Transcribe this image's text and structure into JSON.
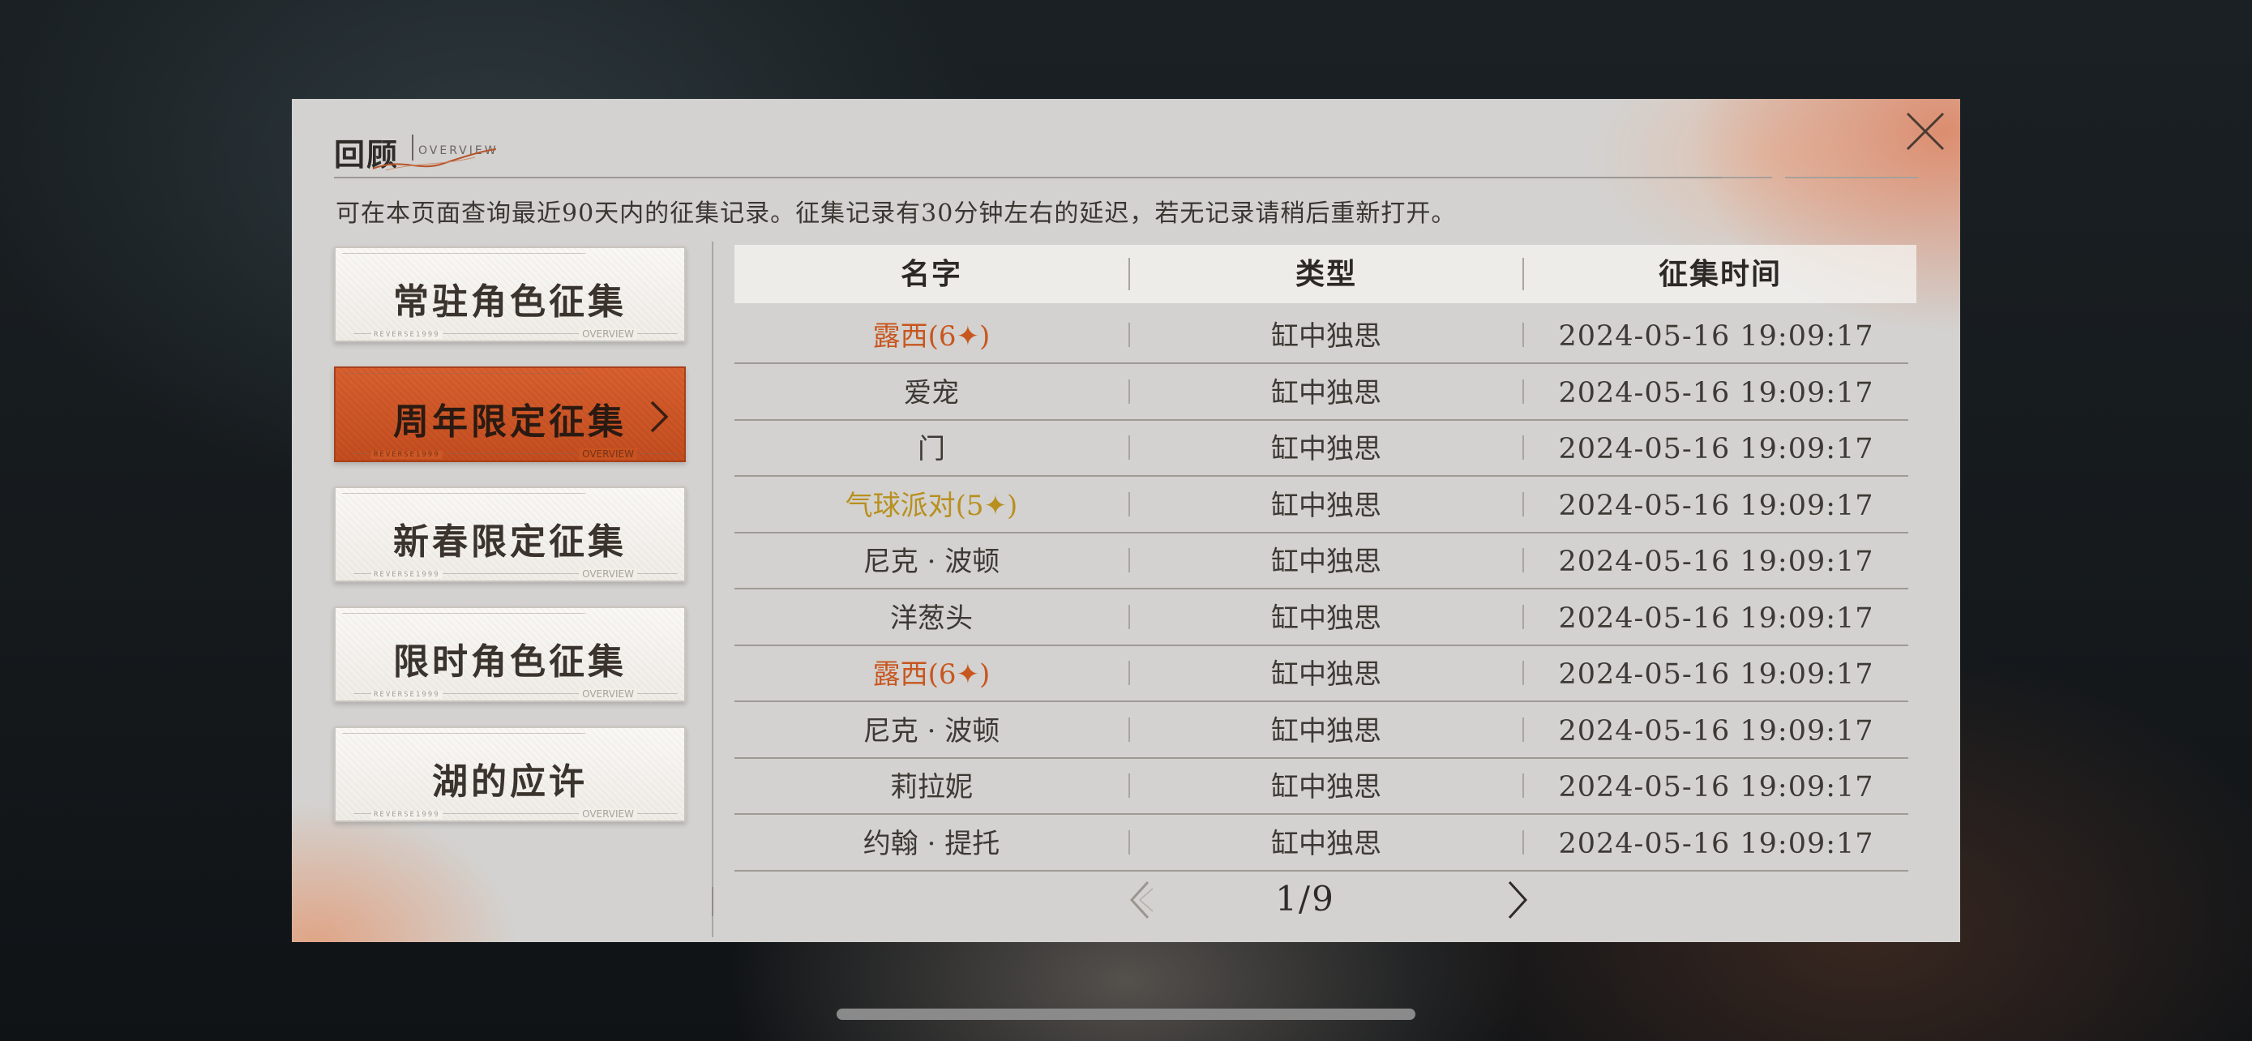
{
  "header": {
    "title": "回顾",
    "subtitle": "OVERVIEW",
    "description": "可在本页面查询最近90天内的征集记录。征集记录有30分钟左右的延迟，若无记录请稍后重新打开。"
  },
  "nav": {
    "items": [
      {
        "label": "常驻角色征集",
        "active": false
      },
      {
        "label": "周年限定征集",
        "active": true
      },
      {
        "label": "新春限定征集",
        "active": false
      },
      {
        "label": "限时角色征集",
        "active": false
      },
      {
        "label": "湖的应许",
        "active": false
      }
    ],
    "deco_text": "REVERSE1999",
    "deco_overview": "OVERVIEW"
  },
  "table": {
    "headers": [
      "名字",
      "类型",
      "征集时间"
    ],
    "rows": [
      {
        "name": "露西(6✦)",
        "rarity": 6,
        "type": "缸中独思",
        "time": "2024-05-16 19:09:17"
      },
      {
        "name": "爱宠",
        "rarity": 0,
        "type": "缸中独思",
        "time": "2024-05-16 19:09:17"
      },
      {
        "name": "门",
        "rarity": 0,
        "type": "缸中独思",
        "time": "2024-05-16 19:09:17"
      },
      {
        "name": "气球派对(5✦)",
        "rarity": 5,
        "type": "缸中独思",
        "time": "2024-05-16 19:09:17"
      },
      {
        "name": "尼克 · 波顿",
        "rarity": 0,
        "type": "缸中独思",
        "time": "2024-05-16 19:09:17"
      },
      {
        "name": "洋葱头",
        "rarity": 0,
        "type": "缸中独思",
        "time": "2024-05-16 19:09:17"
      },
      {
        "name": "露西(6✦)",
        "rarity": 6,
        "type": "缸中独思",
        "time": "2024-05-16 19:09:17"
      },
      {
        "name": "尼克 · 波顿",
        "rarity": 0,
        "type": "缸中独思",
        "time": "2024-05-16 19:09:17"
      },
      {
        "name": "莉拉妮",
        "rarity": 0,
        "type": "缸中独思",
        "time": "2024-05-16 19:09:17"
      },
      {
        "name": "约翰 · 提托",
        "rarity": 0,
        "type": "缸中独思",
        "time": "2024-05-16 19:09:17"
      }
    ]
  },
  "pager": {
    "text": "1/9"
  },
  "colors": {
    "accent": "#c8561f",
    "rarity_six": "#c8561f",
    "rarity_five": "#b8901f",
    "panel": "#d3d2d0"
  },
  "icons": {
    "close": "close-icon",
    "prev": "chevron-left-icon",
    "next": "chevron-right-icon",
    "nav_active": "chevron-right-icon"
  }
}
